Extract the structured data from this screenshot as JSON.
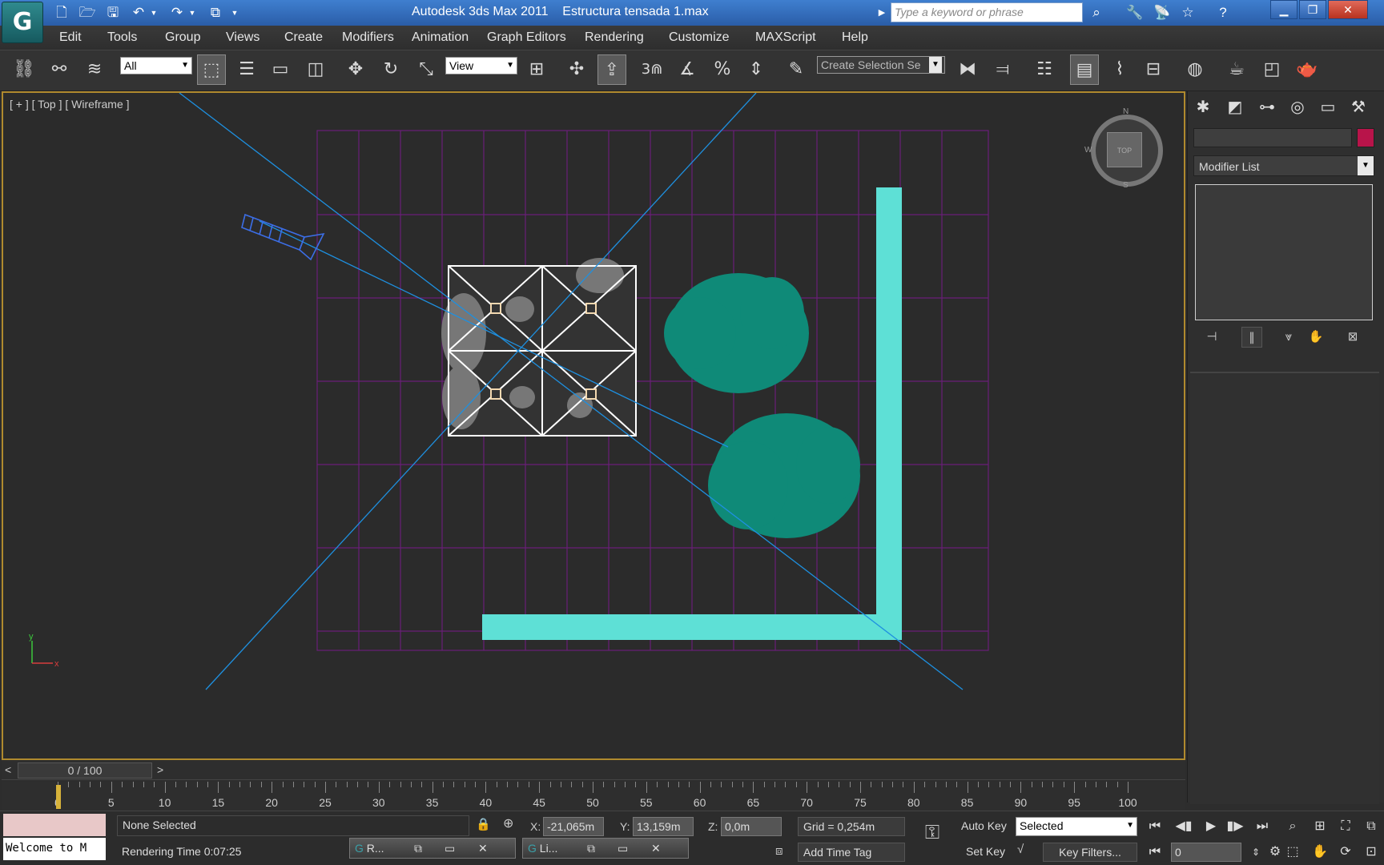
{
  "title_bar": {
    "app": "Autodesk 3ds Max  2011",
    "file": "Estructura tensada 1.max",
    "search_placeholder": "Type a keyword or phrase"
  },
  "menu": [
    "Edit",
    "Tools",
    "Group",
    "Views",
    "Create",
    "Modifiers",
    "Animation",
    "Graph Editors",
    "Rendering",
    "Customize",
    "MAXScript",
    "Help"
  ],
  "toolbar": {
    "selection_filter": "All",
    "ref_coord": "View",
    "named_selection": "Create Selection Se",
    "snap_label": "3"
  },
  "viewport": {
    "label": "[ + ] [ Top ] [ Wireframe ]",
    "navcube_label": "TOP",
    "compass_n": "N",
    "compass_s": "S",
    "compass_w": "W",
    "axis_x": "x",
    "axis_y": "y"
  },
  "command_panel": {
    "modifier_list": "Modifier List"
  },
  "time_slider": {
    "position": "0 / 100",
    "prev": "<",
    "next": ">"
  },
  "ruler_labels": [
    "0",
    "5",
    "10",
    "15",
    "20",
    "25",
    "30",
    "35",
    "40",
    "45",
    "50",
    "55",
    "60",
    "65",
    "70",
    "75",
    "80",
    "85",
    "90",
    "95",
    "100"
  ],
  "status": {
    "welcome": "Welcome to M",
    "selection": "None Selected",
    "rendering_time": "Rendering Time  0:07:25",
    "x_label": "X:",
    "x_value": "-21,065m",
    "y_label": "Y:",
    "y_value": "13,159m",
    "z_label": "Z:",
    "z_value": "0,0m",
    "grid": "Grid = 0,254m",
    "add_time_tag": "Add Time Tag",
    "auto_key": "Auto Key",
    "set_key": "Set Key",
    "key_mode": "Selected",
    "key_filters": "Key Filters...",
    "frame": "0",
    "task1": "R...",
    "task2": "Li..."
  },
  "colors": {
    "path": "#5ee0d6",
    "trees": "#0f8a78",
    "grid": "#6a1e78",
    "camera_lines": "#1e90e0",
    "viewport_border": "#b08a2e",
    "object_color": "#b8144a"
  }
}
